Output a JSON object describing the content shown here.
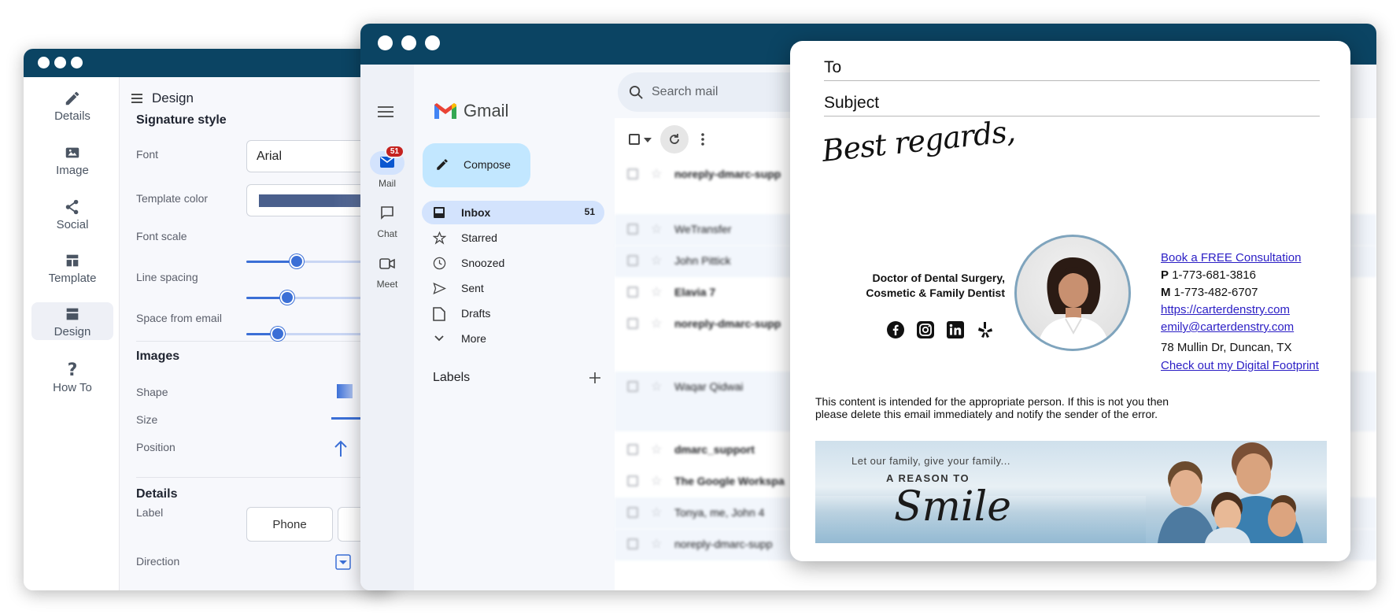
{
  "editor": {
    "nav": [
      {
        "label": "Details",
        "icon": "pencil-icon"
      },
      {
        "label": "Image",
        "icon": "image-icon"
      },
      {
        "label": "Social",
        "icon": "share-icon"
      },
      {
        "label": "Template",
        "icon": "template-icon"
      },
      {
        "label": "Design",
        "icon": "design-icon",
        "active": true
      },
      {
        "label": "How To",
        "icon": "help-icon"
      }
    ],
    "header_title": "Design",
    "signature_style": {
      "title": "Signature style",
      "font_label": "Font",
      "font_value": "Arial",
      "template_color_label": "Template color",
      "font_scale_label": "Font scale",
      "font_scale_level": 0.32,
      "line_spacing_label": "Line spacing",
      "line_spacing_level": 0.26,
      "space_label": "Space from email",
      "space_level": 0.2
    },
    "images": {
      "title": "Images",
      "shape_label": "Shape",
      "size_label": "Size",
      "position_label": "Position"
    },
    "details": {
      "title": "Details",
      "label_label": "Label",
      "label_option": "Phone",
      "direction_label": "Direction"
    }
  },
  "gmail": {
    "logo_text": "Gmail",
    "search_placeholder": "Search mail",
    "compose_label": "Compose",
    "rail": [
      {
        "label": "Mail",
        "badge": "51"
      },
      {
        "label": "Chat"
      },
      {
        "label": "Meet"
      }
    ],
    "folders": [
      {
        "label": "Inbox",
        "count": "51",
        "active": true
      },
      {
        "label": "Starred"
      },
      {
        "label": "Snoozed"
      },
      {
        "label": "Sent"
      },
      {
        "label": "Drafts"
      },
      {
        "label": "More"
      }
    ],
    "labels_title": "Labels",
    "mail_rows": [
      {
        "sender": "noreply-dmarc-supp"
      },
      {
        "sender": "WeTransfer"
      },
      {
        "sender": "John Pittick"
      },
      {
        "sender": "Elavia 7"
      },
      {
        "sender": "noreply-dmarc-supp"
      },
      {
        "sender": "Waqar Qidwai"
      },
      {
        "sender": "dmarc_support"
      },
      {
        "sender": "The Google Workspa"
      },
      {
        "sender": "Tonya, me, John 4"
      },
      {
        "sender": "noreply-dmarc-supp"
      }
    ]
  },
  "compose": {
    "to_label": "To",
    "subject_label": "Subject",
    "signoff": "Best regards,",
    "title_line1": "Doctor of Dental Surgery,",
    "title_line2": "Cosmetic & Family Dentist",
    "social_icons": [
      "facebook-icon",
      "instagram-icon",
      "linkedin-icon",
      "yelp-icon"
    ],
    "cta_link": "Book a FREE Consultation",
    "phone_prefix": "P",
    "phone": "1-773-681-3816",
    "mobile_prefix": "M",
    "mobile": "1-773-482-6707",
    "website": "https://carterdenstry.com",
    "email": "emily@carterdenstry.com",
    "address": "78 Mullin Dr, Duncan, TX",
    "footprint_link": "Check out my Digital Footprint",
    "disclaimer_line1": "This content is intended for the appropriate person. If this is not you then",
    "disclaimer_line2": "please delete this email immediately and notify the sender of the error.",
    "banner_small": "Let our family, give your family...",
    "banner_medium": "A REASON TO",
    "banner_large": "Smile"
  },
  "colors": {
    "titlebar": "#0b4463",
    "accent_blue": "#3b6fd6",
    "gmail_selected": "#d3e3fd",
    "link": "#2b1ec5"
  }
}
